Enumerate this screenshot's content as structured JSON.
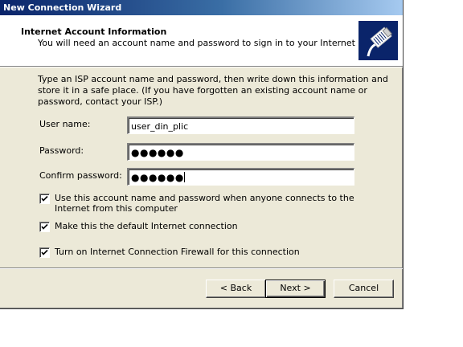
{
  "window": {
    "title": "New Connection Wizard"
  },
  "header": {
    "title": "Internet Account Information",
    "subtitle": "You will need an account name and password to sign in to your Internet account.",
    "icon": "network-cable-icon"
  },
  "content": {
    "description": "Type an ISP account name and password, then write down this information and store it in a safe place. (If you have forgotten an existing account name or password, contact your ISP.)",
    "fields": {
      "user_name": {
        "label": "User name:",
        "value": "user_din_plic"
      },
      "password": {
        "label": "Password:",
        "value": "●●●●●●"
      },
      "confirm_password": {
        "label": "Confirm password:",
        "value": "●●●●●●"
      }
    },
    "checkboxes": {
      "use_for_anyone": {
        "label": "Use this account  name and password when anyone connects to the Internet from this computer",
        "checked": true
      },
      "default_connection": {
        "label": "Make this the default Internet connection",
        "checked": true
      },
      "firewall": {
        "label": "Turn on Internet Connection Firewall for this connection",
        "checked": true
      }
    }
  },
  "buttons": {
    "back": "< Back",
    "next": "Next >",
    "cancel": "Cancel"
  }
}
